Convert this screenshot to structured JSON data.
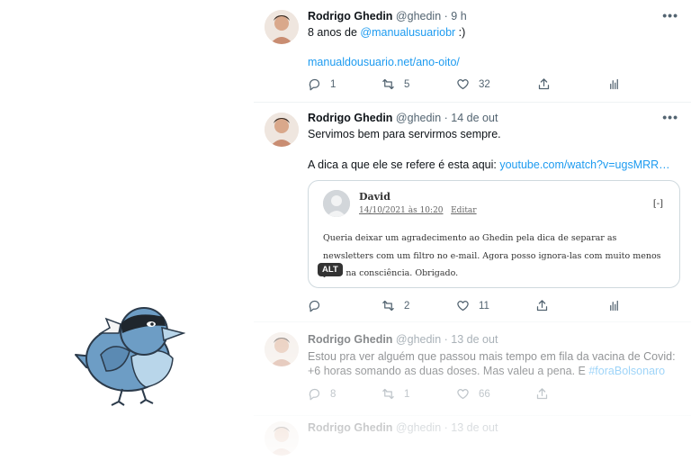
{
  "tweets": [
    {
      "name": "Rodrigo Ghedin",
      "handle": "@ghedin",
      "dot": "·",
      "time": "9 h",
      "text_plain": "8 anos de ",
      "mention": "@manualusuariobr",
      "text_after": " :)",
      "link": "manualdousuario.net/ano-oito/",
      "replies": "1",
      "retweets": "5",
      "likes": "32"
    },
    {
      "name": "Rodrigo Ghedin",
      "handle": "@ghedin",
      "dot": "·",
      "time": "14 de out",
      "text_line1": "Servimos bem para servirmos sempre.",
      "text_line2_plain": "A dica a que ele se refere é esta aqui: ",
      "text_line2_link": "youtube.com/watch?v=ugsMRR…",
      "quote": {
        "name": "David",
        "date": "14/10/2021 às 10:20",
        "edit": "Editar",
        "collapse": "[-]",
        "text": "Queria deixar um agradecimento ao Ghedin pela dica de separar as newsletters com um filtro no e-mail. Agora posso ignora-las com muito menos peso na consciência. Obrigado.",
        "alt": "ALT"
      },
      "replies": "",
      "retweets": "2",
      "likes": "11"
    },
    {
      "name": "Rodrigo Ghedin",
      "handle": "@ghedin",
      "dot": "·",
      "time": "13 de out",
      "text_line1": "Estou pra ver alguém que passou mais tempo em fila da vacina de Covid:",
      "text_line2_plain": "+6 horas somando as duas doses. Mas valeu a pena. E ",
      "hashtag": "#foraBolsonaro",
      "replies": "8",
      "retweets": "1",
      "likes": "66"
    },
    {
      "name": "Rodrigo Ghedin",
      "handle": "@ghedin",
      "dot": "·",
      "time": "13 de out"
    }
  ],
  "more_label": "•••",
  "colors": {
    "link": "#1d9bf0",
    "muted": "#536471",
    "mascot_blue": "#6d9dc5"
  }
}
